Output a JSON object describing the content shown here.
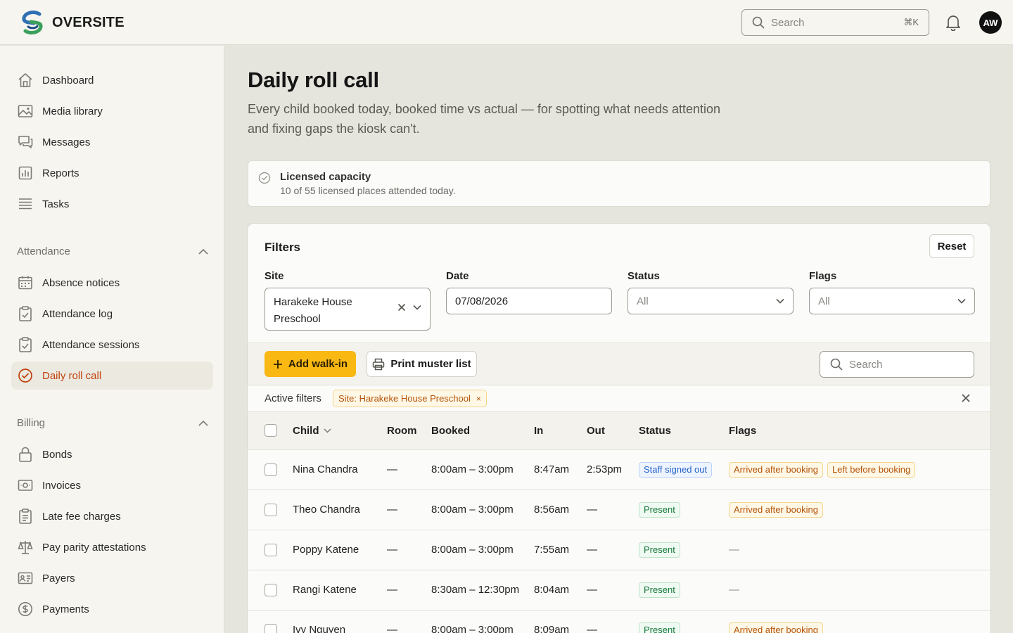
{
  "app": {
    "name": "OVERSITE"
  },
  "header": {
    "search_placeholder": "Search",
    "search_shortcut": "⌘K",
    "avatar_initials": "AW"
  },
  "sidebar": {
    "top_items": [
      {
        "label": "Dashboard",
        "icon": "home-icon"
      },
      {
        "label": "Media library",
        "icon": "image-icon"
      },
      {
        "label": "Messages",
        "icon": "chat-icon"
      },
      {
        "label": "Reports",
        "icon": "bar-chart-icon"
      },
      {
        "label": "Tasks",
        "icon": "list-icon"
      }
    ],
    "attendance": {
      "title": "Attendance",
      "items": [
        {
          "label": "Absence notices",
          "icon": "calendar-icon"
        },
        {
          "label": "Attendance log",
          "icon": "clipboard-check-icon"
        },
        {
          "label": "Attendance sessions",
          "icon": "clipboard-check-icon"
        },
        {
          "label": "Daily roll call",
          "icon": "circle-check-icon",
          "active": true
        }
      ]
    },
    "billing": {
      "title": "Billing",
      "items": [
        {
          "label": "Bonds",
          "icon": "lock-icon"
        },
        {
          "label": "Invoices",
          "icon": "banknote-icon"
        },
        {
          "label": "Late fee charges",
          "icon": "clipboard-list-icon"
        },
        {
          "label": "Pay parity attestations",
          "icon": "scale-icon"
        },
        {
          "label": "Payers",
          "icon": "id-card-icon"
        },
        {
          "label": "Payments",
          "icon": "dollar-circle-icon"
        }
      ]
    }
  },
  "page": {
    "title": "Daily roll call",
    "subtitle": "Every child booked today, booked time vs actual — for spotting what needs attention and fixing gaps the kiosk can't."
  },
  "capacity": {
    "title": "Licensed capacity",
    "detail": "10 of 55 licensed places attended today."
  },
  "filters": {
    "title": "Filters",
    "reset_label": "Reset",
    "site": {
      "label": "Site",
      "value": "Harakeke House Preschool"
    },
    "date": {
      "label": "Date",
      "value": "07/08/2026"
    },
    "status": {
      "label": "Status",
      "placeholder": "All"
    },
    "flags": {
      "label": "Flags",
      "placeholder": "All"
    }
  },
  "toolbar": {
    "add_walkin_label": "Add walk-in",
    "print_label": "Print muster list",
    "search_placeholder": "Search"
  },
  "active_filters": {
    "label": "Active filters",
    "chips": [
      "Site: Harakeke House Preschool"
    ]
  },
  "table": {
    "headers": {
      "child": "Child",
      "room": "Room",
      "booked": "Booked",
      "in": "In",
      "out": "Out",
      "status": "Status",
      "flags": "Flags"
    },
    "rows": [
      {
        "child": "Nina Chandra",
        "room": "—",
        "booked": "8:00am – 3:00pm",
        "in": "8:47am",
        "out": "2:53pm",
        "status": "Staff signed out",
        "status_tone": "blue",
        "flags": [
          "Arrived after booking",
          "Left before booking"
        ]
      },
      {
        "child": "Theo Chandra",
        "room": "—",
        "booked": "8:00am – 3:00pm",
        "in": "8:56am",
        "out": "—",
        "status": "Present",
        "status_tone": "green",
        "flags": [
          "Arrived after booking"
        ]
      },
      {
        "child": "Poppy Katene",
        "room": "—",
        "booked": "8:00am – 3:00pm",
        "in": "7:55am",
        "out": "—",
        "status": "Present",
        "status_tone": "green",
        "flags": []
      },
      {
        "child": "Rangi Katene",
        "room": "—",
        "booked": "8:30am – 12:30pm",
        "in": "8:04am",
        "out": "—",
        "status": "Present",
        "status_tone": "green",
        "flags": []
      },
      {
        "child": "Ivy Nguyen",
        "room": "—",
        "booked": "8:00am – 3:00pm",
        "in": "8:09am",
        "out": "—",
        "status": "Present",
        "status_tone": "green",
        "flags": [
          "Arrived after booking"
        ]
      }
    ],
    "empty_flag": "—"
  },
  "colors": {
    "accent": "#f9b812",
    "active_nav": "#c2410c",
    "status_blue": "#2563c9",
    "status_green": "#157a3a",
    "flag_amber": "#b45309"
  }
}
